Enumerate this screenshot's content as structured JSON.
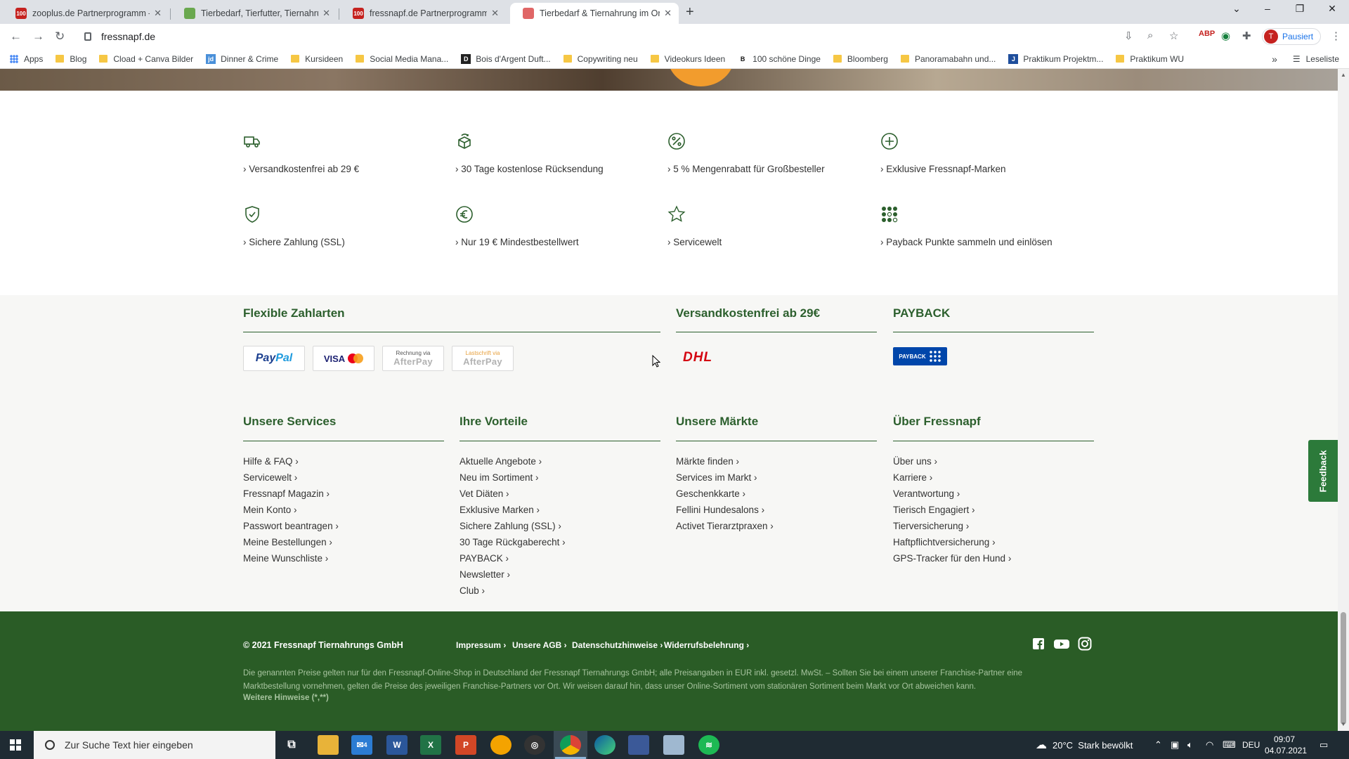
{
  "browser": {
    "tabs": [
      {
        "title": "zooplus.de Partnerprogramm – v",
        "favicon": "100",
        "favicon_color": "#c5221f"
      },
      {
        "title": "Tierbedarf, Tierfutter, Tiernahrun",
        "favicon": "",
        "favicon_color": "#6aa84f"
      },
      {
        "title": "fressnapf.de Partnerprogramm –",
        "favicon": "100",
        "favicon_color": "#c5221f"
      },
      {
        "title": "Tierbedarf & Tiernahrung im Onl",
        "favicon": "",
        "favicon_color": "#e06666"
      }
    ],
    "url": "fressnapf.de",
    "profile_label": "Pausiert",
    "profile_initial": "T",
    "bookmarks": [
      {
        "label": "Apps",
        "type": "apps"
      },
      {
        "label": "Blog",
        "type": "folder"
      },
      {
        "label": "Cload + Canva Bilder",
        "type": "folder"
      },
      {
        "label": "Dinner & Crime",
        "type": "site",
        "icon": "jd",
        "icon_color": "#4a90d9"
      },
      {
        "label": "Kursideen",
        "type": "folder"
      },
      {
        "label": "Social Media Mana...",
        "type": "folder"
      },
      {
        "label": "Bois d'Argent Duft...",
        "type": "site",
        "icon": "D",
        "icon_color": "#222222"
      },
      {
        "label": "Copywriting neu",
        "type": "folder"
      },
      {
        "label": "Videokurs Ideen",
        "type": "folder"
      },
      {
        "label": "100 schöne Dinge",
        "type": "site",
        "icon": "B",
        "icon_color": "#111111"
      },
      {
        "label": "Bloomberg",
        "type": "folder"
      },
      {
        "label": "Panoramabahn und...",
        "type": "folder"
      },
      {
        "label": "Praktikum Projektm...",
        "type": "site",
        "icon": "J",
        "icon_color": "#1f4e9c"
      },
      {
        "label": "Praktikum WU",
        "type": "folder"
      }
    ],
    "more_bookmarks": "»",
    "reading_list": "Leseliste"
  },
  "usps": [
    {
      "label": "› Versandkostenfrei ab 29 €",
      "icon": "truck-icon"
    },
    {
      "label": "› 30 Tage kostenlose Rücksendung",
      "icon": "return-package-icon"
    },
    {
      "label": "› 5 % Mengenrabatt für Großbesteller",
      "icon": "percent-icon"
    },
    {
      "label": "› Exklusive Fressnapf-Marken",
      "icon": "plus-circle-icon"
    },
    {
      "label": "› Sichere Zahlung (SSL)",
      "icon": "shield-icon"
    },
    {
      "label": "› Nur 19 € Mindestbestellwert",
      "icon": "euro-icon"
    },
    {
      "label": "› Servicewelt",
      "icon": "star-icon"
    },
    {
      "label": "› Payback Punkte sammeln und einlösen",
      "icon": "payback-dots-icon"
    }
  ],
  "payment": {
    "heading": "Flexible Zahlarten",
    "paypal": [
      "Pay",
      "Pal"
    ],
    "visa": "VISA",
    "afterpay_invoice": [
      "Rechnung via",
      "AfterPay"
    ],
    "afterpay_debit": [
      "Lastschrift via",
      "AfterPay"
    ]
  },
  "shipping": {
    "heading": "Versandkostenfrei ab 29€",
    "carrier": "DHL"
  },
  "payback": {
    "heading": "PAYBACK",
    "logo_text": "PAYBACK"
  },
  "columns": [
    {
      "heading": "Unsere Services",
      "links": [
        "Hilfe & FAQ ›",
        "Servicewelt ›",
        "Fressnapf Magazin ›",
        "Mein Konto ›",
        "Passwort beantragen ›",
        "Meine Bestellungen ›",
        "Meine Wunschliste ›"
      ]
    },
    {
      "heading": "Ihre Vorteile",
      "links": [
        "Aktuelle Angebote ›",
        "Neu im Sortiment ›",
        "Vet Diäten ›",
        "Exklusive Marken ›",
        "Sichere Zahlung (SSL) ›",
        "30 Tage Rückgaberecht ›",
        "PAYBACK ›",
        "Newsletter ›",
        "Club ›"
      ]
    },
    {
      "heading": "Unsere Märkte",
      "links": [
        "Märkte finden ›",
        "Services im Markt ›",
        "Geschenkkarte ›",
        "Fellini Hundesalons ›",
        "Activet Tierarztpraxen ›"
      ]
    },
    {
      "heading": "Über Fressnapf",
      "links": [
        "Über uns ›",
        "Karriere ›",
        "Verantwortung ›",
        "Tierisch Engagiert ›",
        "Tierversicherung ›",
        "Haftpflichtversicherung ›",
        "GPS-Tracker für den Hund ›"
      ]
    }
  ],
  "feedback_label": "Feedback",
  "bottom": {
    "copyright": "© 2021 Fressnapf Tiernahrungs GmbH",
    "legal_links": [
      "Impressum ›",
      "Unsere AGB ›",
      "Datenschutzhinweise ›",
      "Widerrufsbelehrung ›"
    ],
    "disclaimer": "Die genannten Preise gelten nur für den Fressnapf-Online-Shop in Deutschland der Fressnapf Tiernahrungs GmbH; alle Preisangaben in EUR inkl. gesetzl. MwSt. – Sollten Sie bei einem unserer Franchise-Partner eine Marktbestellung vornehmen, gelten die Preise des jeweiligen Franchise-Partners vor Ort. Wir weisen darauf hin, dass unser Online-Sortiment vom stationären Sortiment beim Markt vor Ort abweichen kann.",
    "more_notes": "Weitere Hinweise (*,**)"
  },
  "taskbar": {
    "search_placeholder": "Zur Suche Text hier eingeben",
    "mail_badge": "4",
    "weather": "20°C  Stark bewölkt",
    "language": "DEU",
    "time": "09:07",
    "date": "04.07.2021"
  },
  "colors": {
    "brand_green": "#2c5f2d",
    "footer_dark": "#2a5c26",
    "feedback": "#2c7a3a"
  }
}
